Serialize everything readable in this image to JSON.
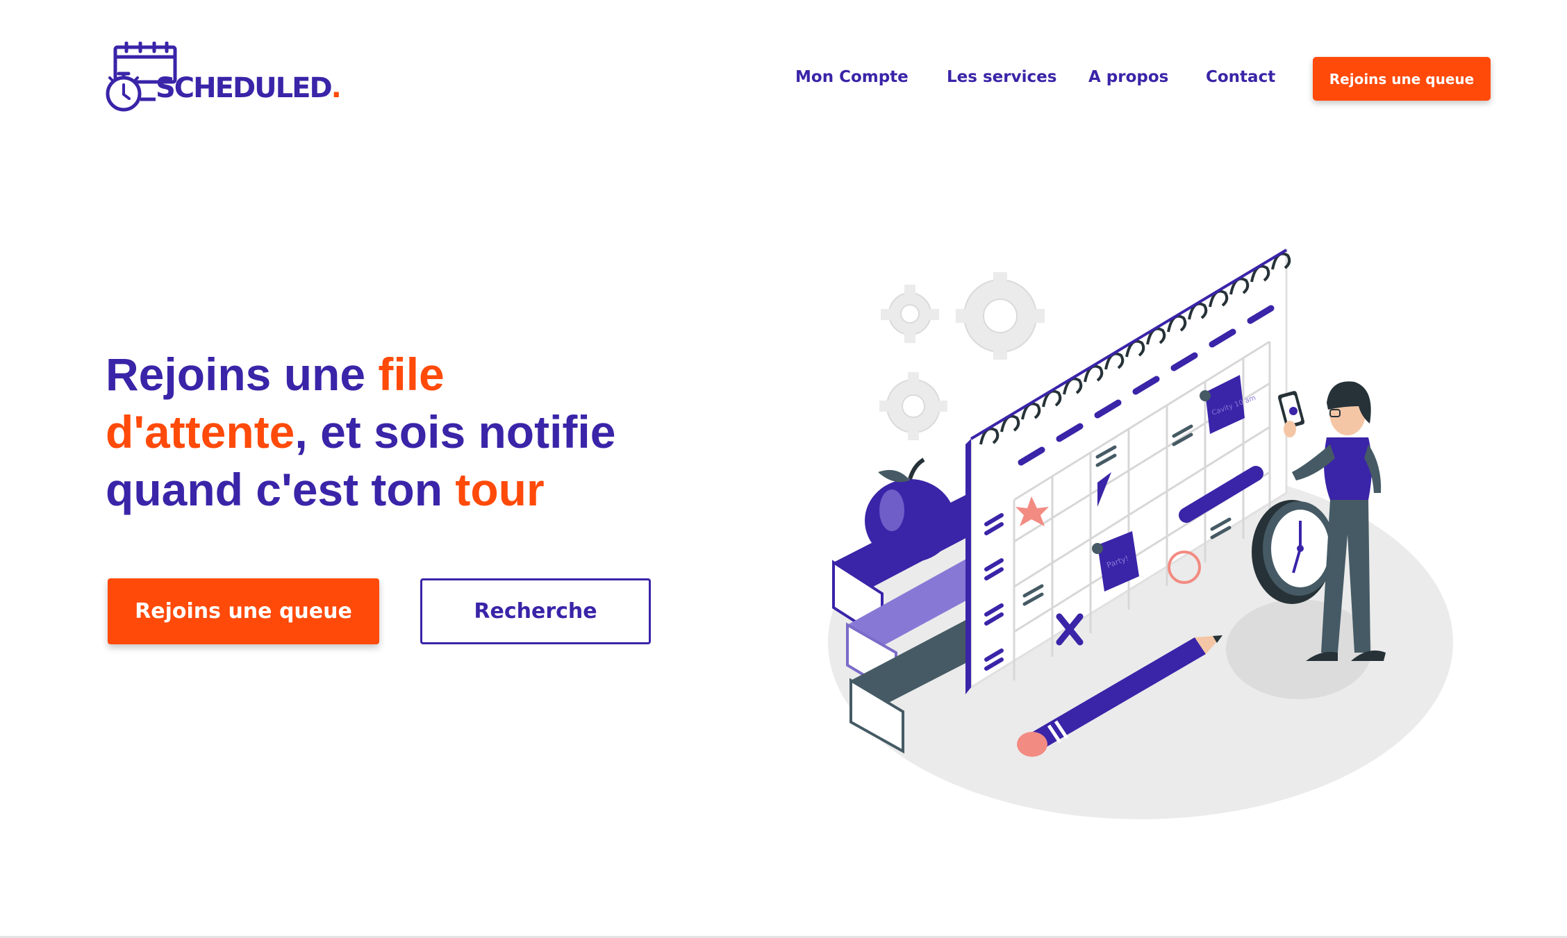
{
  "brand": {
    "name": "SCHEDULED",
    "dot": "."
  },
  "nav": {
    "links": [
      "Mon Compte",
      "Les services",
      "A propos",
      "Contact"
    ],
    "cta": "Rejoins une queue"
  },
  "hero": {
    "headline": {
      "p1": "Rejoins une ",
      "h1": "file",
      "h2": "d'attente",
      "p2": ", et sois notifie",
      "p3": "quand c'est ton ",
      "h3": "tour"
    },
    "primary_button": "Rejoins une queue",
    "secondary_button": "Recherche"
  },
  "illustration": {
    "notes": [
      "Cavity 10 am",
      "Party!"
    ]
  },
  "colors": {
    "primary": "#3a24a8",
    "accent": "#ff4a0a",
    "background": "#ffffff"
  },
  "icons": {
    "logo": "calendar-stopwatch-icon",
    "illustration": "calendar-person-illustration"
  }
}
